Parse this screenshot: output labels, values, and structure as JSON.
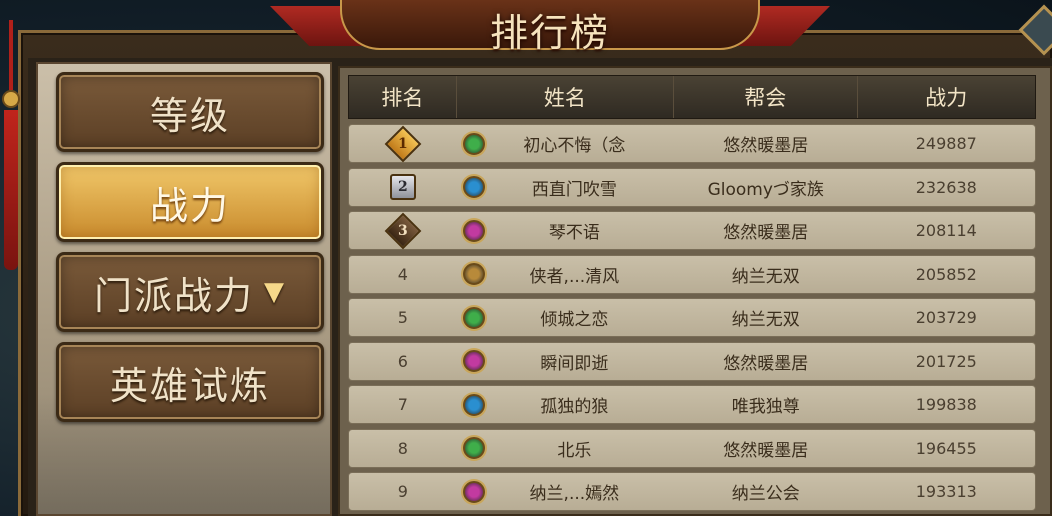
{
  "title": "排行榜",
  "tabs": [
    {
      "label": "等级",
      "active": false
    },
    {
      "label": "战力",
      "active": true
    },
    {
      "label": "门派战力",
      "active": false,
      "dropdown": "▼"
    },
    {
      "label": "英雄试炼",
      "active": false
    }
  ],
  "table": {
    "headers": [
      "排名",
      "姓名",
      "帮会",
      "战力"
    ],
    "rows": [
      {
        "rank": "1",
        "medal": "gold",
        "emblem": "green",
        "name": "初心不悔（念",
        "guild": "悠然暖墨居",
        "power": "249887"
      },
      {
        "rank": "2",
        "medal": "silver",
        "emblem": "blue",
        "name": "西直门吹雪",
        "guild": "Gloomyづ家族",
        "power": "232638"
      },
      {
        "rank": "3",
        "medal": "bronze",
        "emblem": "pink",
        "name": "琴不语",
        "guild": "悠然暖墨居",
        "power": "208114"
      },
      {
        "rank": "4",
        "medal": "",
        "emblem": "brown",
        "name": "侠者,...清风",
        "guild": "纳兰无双",
        "power": "205852"
      },
      {
        "rank": "5",
        "medal": "",
        "emblem": "green",
        "name": "倾城之恋",
        "guild": "纳兰无双",
        "power": "203729"
      },
      {
        "rank": "6",
        "medal": "",
        "emblem": "pink",
        "name": "瞬间即逝",
        "guild": "悠然暖墨居",
        "power": "201725"
      },
      {
        "rank": "7",
        "medal": "",
        "emblem": "blue",
        "name": "孤独的狼",
        "guild": "唯我独尊",
        "power": "199838"
      },
      {
        "rank": "8",
        "medal": "",
        "emblem": "green",
        "name": "北乐",
        "guild": "悠然暖墨居",
        "power": "196455"
      },
      {
        "rank": "9",
        "medal": "",
        "emblem": "pink",
        "name": "纳兰,...嫣然",
        "guild": "纳兰公会",
        "power": "193313"
      }
    ]
  },
  "colors": {
    "emblem_green": "#3fae4a",
    "emblem_blue": "#2a8fd0",
    "emblem_pink": "#c23aa0",
    "emblem_brown": "#b88a3a",
    "active_tab": "#e2a84a"
  }
}
